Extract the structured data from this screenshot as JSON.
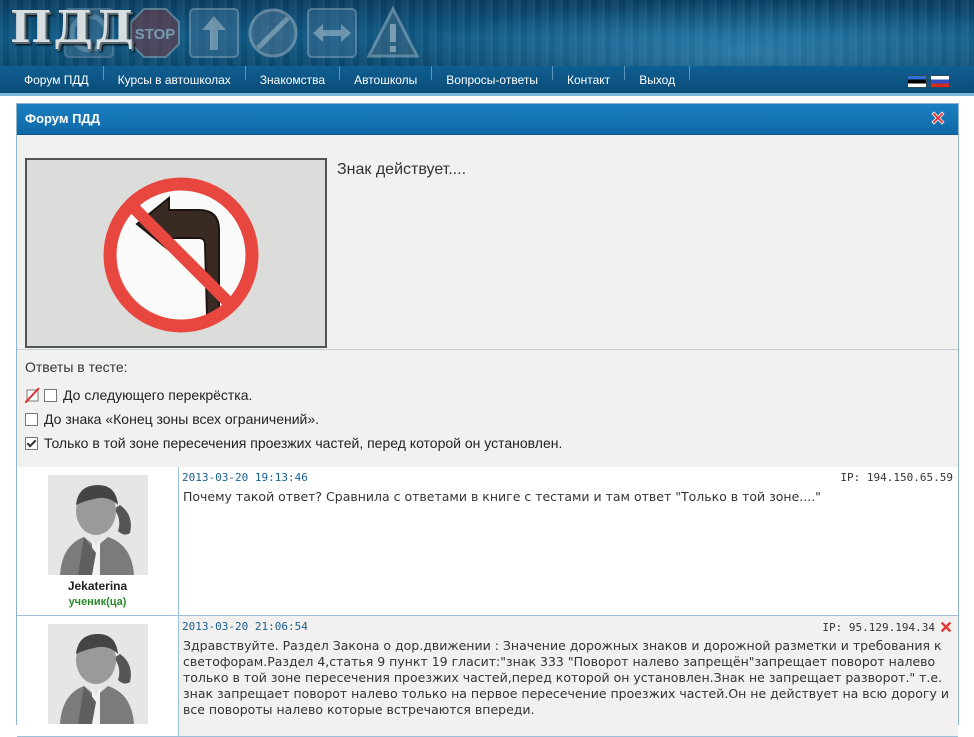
{
  "header": {
    "logo_text": "ПДД",
    "decor_sign_names": [
      "stop-sign-icon",
      "arrow-up-sign-icon",
      "end-of-restrictions-sign-icon",
      "two-way-arrow-sign-icon",
      "warning-sign-icon"
    ]
  },
  "nav": {
    "items": [
      "Форум ПДД",
      "Курсы в автошколах",
      "Знакомства",
      "Автошколы",
      "Вопросы-ответы",
      "Контакт",
      "Выход"
    ],
    "flags": [
      "flag-ee-icon",
      "flag-ru-icon"
    ]
  },
  "panel": {
    "title": "Форум ПДД",
    "question_text": "Знак действует....",
    "question_image": "no-left-turn-sign",
    "answers_title": "Ответы в тесте:",
    "answers": [
      {
        "text": "До следующего перекрёстка.",
        "checked": false,
        "marked_wrong": true
      },
      {
        "text": "До знака «Конец зоны всех ограничений».",
        "checked": false,
        "marked_wrong": false
      },
      {
        "text": "Только в той зоне пересечения проезжих частей, перед которой он установлен.",
        "checked": true,
        "marked_wrong": false
      }
    ]
  },
  "posts": [
    {
      "username": "Jekaterina",
      "rank": "ученик(ца)",
      "date": "2013-03-20 19:13:46",
      "ip": "IP: 194.150.65.59",
      "text": "Почему такой ответ? Сравнила с ответами в книге с тестами и там ответ \"Только в той зоне....\"",
      "deletable": false
    },
    {
      "username": "",
      "rank": "",
      "date": "2013-03-20 21:06:54",
      "ip": "IP: 95.129.194.34",
      "text": "Здравствуйте. Раздел Закона о дор.движении : Значение дорожных знаков и дорожной разметки и требования к светофорам.Раздел 4,статья 9 пункт 19 гласит:\"знак 333 \"Поворот налево запрещён\"запрещает поворот налево только в той зоне пересечения проезжих частей,перед которой он установлен.Знак не запрещает разворот.\" т.е. знак запрещает поворот налево только на первое пересечение проезжих частей.Он не действует на всю дорогу и все повороты налево которые встречаются впереди.",
      "deletable": true
    }
  ],
  "colors": {
    "nav_bg": "#0a4c78",
    "panel_head": "#1b7fc0",
    "date_text": "#1a5f90",
    "rank_green": "#2a8a2a",
    "close_red": "#e23b3b"
  }
}
